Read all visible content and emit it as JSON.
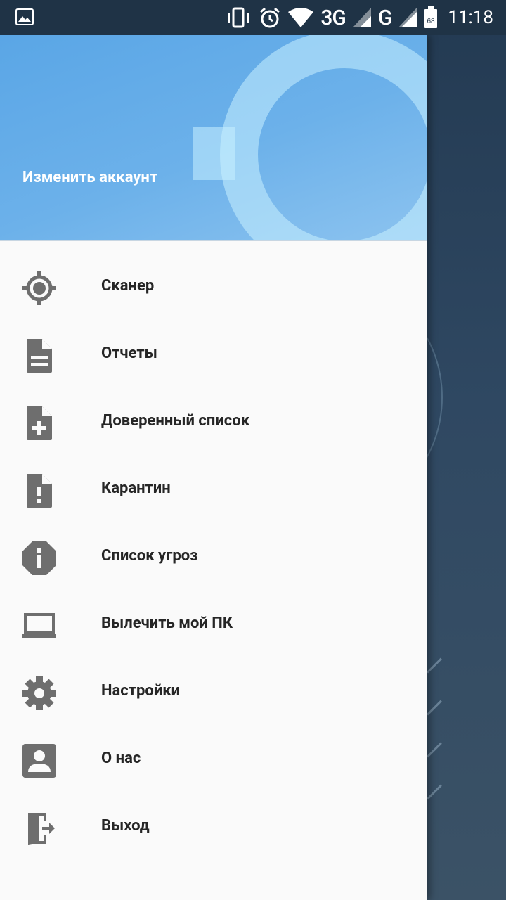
{
  "status_bar": {
    "network_1": "3G",
    "network_2": "G",
    "battery_level": "68",
    "time": "11:18",
    "icons": [
      "image-icon",
      "vibrate-icon",
      "alarm-icon",
      "wifi-icon",
      "signal-icon",
      "battery-icon"
    ]
  },
  "drawer": {
    "header": {
      "account_label": "Изменить аккаунт",
      "background_color": "#5aa6e6"
    },
    "items": [
      {
        "label": "Сканер",
        "icon": "target-icon"
      },
      {
        "label": "Отчеты",
        "icon": "document-icon"
      },
      {
        "label": "Доверенный список",
        "icon": "document-add-icon"
      },
      {
        "label": "Карантин",
        "icon": "document-alert-icon"
      },
      {
        "label": "Список угроз",
        "icon": "alert-octagon-icon"
      },
      {
        "label": "Вылечить мой ПК",
        "icon": "laptop-icon"
      },
      {
        "label": "Настройки",
        "icon": "gear-icon"
      },
      {
        "label": "О нас",
        "icon": "account-box-icon"
      },
      {
        "label": "Выход",
        "icon": "exit-icon"
      }
    ]
  },
  "colors": {
    "icon": "#6e6e6e",
    "text": "#262626",
    "drawer_bg": "#fafafa",
    "status_bar_bg": "#1f3346"
  }
}
